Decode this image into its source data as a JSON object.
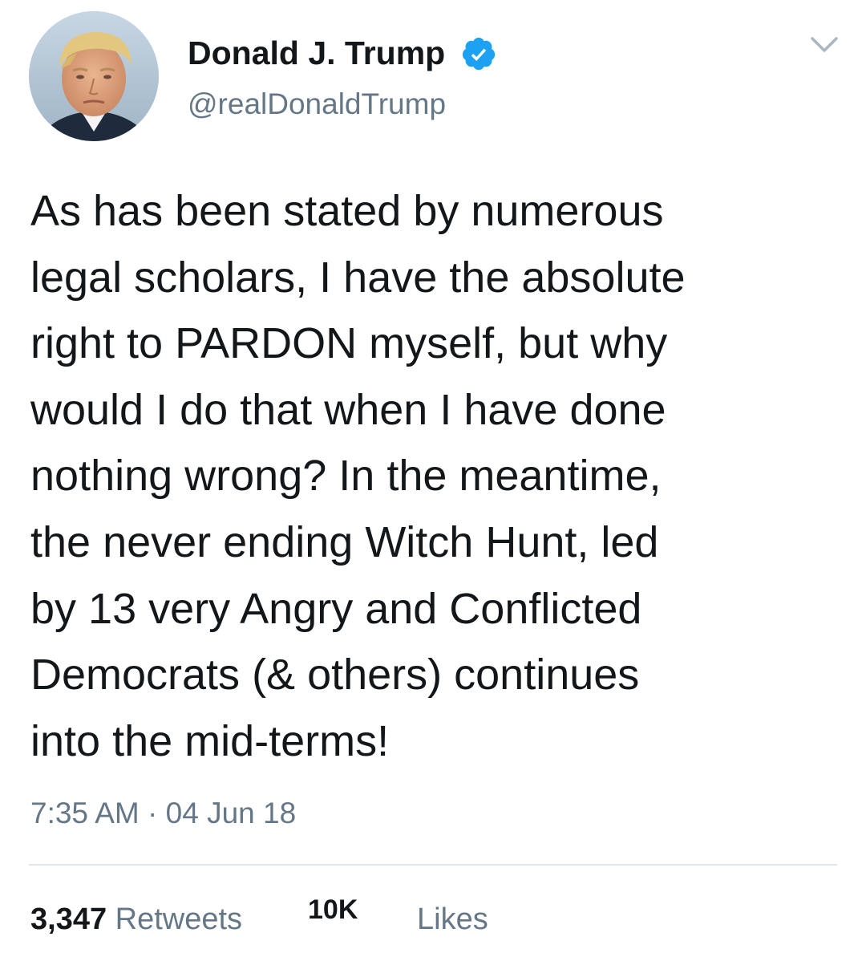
{
  "author": {
    "display_name": "Donald J. Trump",
    "handle": "@realDonaldTrump",
    "verified": true,
    "verified_badge_color": "#1da1f2"
  },
  "tweet": {
    "text": "As has been stated by numerous\nlegal scholars, I have the absolute\nright to PARDON myself, but why\nwould I do that when I have done\nnothing wrong? In the meantime,\nthe never ending Witch Hunt, led\nby 13 very Angry and Conflicted\nDemocrats (& others) continues\ninto the mid-terms!",
    "timestamp": "7:35 AM · 04 Jun 18"
  },
  "stats": {
    "retweets_count": "3,347",
    "retweets_label": "Retweets",
    "likes_count": "10K",
    "likes_label": "Likes"
  },
  "icons": {
    "menu": "chevron-down-icon",
    "verified": "verified-badge-icon",
    "avatar": "avatar"
  },
  "colors": {
    "text_primary": "#14171a",
    "text_secondary": "#657786",
    "divider": "#e1e8ed"
  }
}
